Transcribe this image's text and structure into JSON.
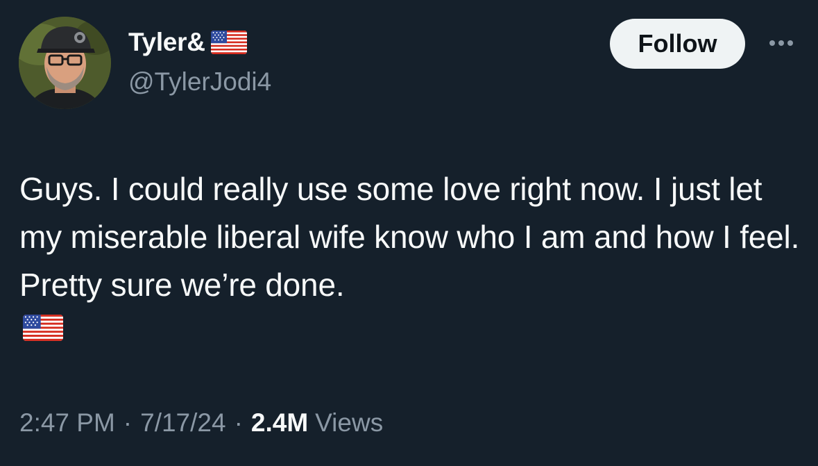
{
  "author": {
    "display_name": "Tyler&",
    "name_emoji": "us-flag-icon",
    "handle": "@TylerJodi4"
  },
  "actions": {
    "follow_label": "Follow",
    "more_icon": "more-horizontal-icon"
  },
  "tweet": {
    "text": "Guys. I could really use some love right now. I just let my miserable liberal wife know who I am and how I feel. Pretty sure we’re done.",
    "trailing_emoji": "us-flag-icon"
  },
  "meta": {
    "time": "2:47 PM",
    "separator": "·",
    "date": "7/17/24",
    "views_count": "2.4M",
    "views_label": "Views"
  },
  "colors": {
    "background": "#15202b",
    "text_primary": "#f7f9f9",
    "text_secondary": "#8b98a5",
    "follow_button_bg": "#eff3f4",
    "follow_button_text": "#0f1419"
  }
}
